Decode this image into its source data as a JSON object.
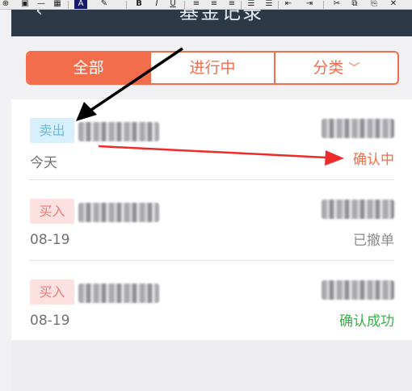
{
  "toolbar": {
    "items": [
      {
        "label": "⊕",
        "icon": "link-icon"
      },
      {
        "label": "▣",
        "icon": "image-icon"
      },
      {
        "label": "—",
        "icon": "line-icon"
      },
      {
        "label": "▦",
        "icon": "table-icon"
      },
      {
        "label": "A",
        "icon": "font-color-icon"
      },
      {
        "label": "✎",
        "icon": "pen-icon"
      },
      {
        "label": "B",
        "icon": "bold-icon"
      },
      {
        "label": "I",
        "icon": "italic-icon"
      },
      {
        "label": "U",
        "icon": "underline-icon"
      },
      {
        "label": "≡",
        "icon": "align-left-icon"
      },
      {
        "label": "≡",
        "icon": "align-center-icon"
      },
      {
        "label": "≡",
        "icon": "align-right-icon"
      },
      {
        "label": "☰",
        "icon": "ordered-list-icon"
      },
      {
        "label": "☰",
        "icon": "unordered-list-icon"
      },
      {
        "label": "⇤",
        "icon": "outdent-icon"
      },
      {
        "label": "⇥",
        "icon": "indent-icon"
      },
      {
        "label": "✂",
        "icon": "cut-icon"
      },
      {
        "label": "⧉",
        "icon": "copy-icon"
      },
      {
        "label": "⎘",
        "icon": "paste-icon"
      },
      {
        "label": "✕",
        "icon": "close-icon"
      }
    ]
  },
  "navbar": {
    "back_icon": "chevron-left-icon",
    "back_glyph": "‹",
    "title": "基金记录"
  },
  "tabs": {
    "all": "全部",
    "in_progress": "进行中",
    "category": "分类",
    "category_chevron": "﹀",
    "accent": "#f26d4b"
  },
  "records": [
    {
      "type": "卖出",
      "kind": "sell",
      "date": "今天",
      "status": "确认中",
      "status_color": "#f26d4b"
    },
    {
      "type": "买入",
      "kind": "buy",
      "date": "08-19",
      "status": "已撤单",
      "status_color": "#8a8a8a"
    },
    {
      "type": "买入",
      "kind": "buy",
      "date": "08-19",
      "status": "确认成功",
      "status_color": "#33b546"
    }
  ],
  "annotations": {
    "black_arrow_color": "#000000",
    "red_arrow_color": "#ee2b2b"
  }
}
